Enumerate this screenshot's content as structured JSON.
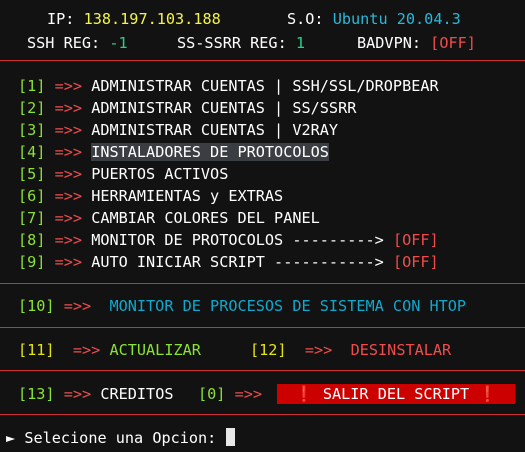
{
  "header": {
    "ip_label": "IP:",
    "ip_value": "138.197.103.188",
    "so_label": "S.O:",
    "so_value": "Ubuntu 20.04.3",
    "ssh_label": "SSH REG:",
    "ssh_value": "-1",
    "ssr_label": "SS-SSRR REG:",
    "ssr_value": "1",
    "badvpn_label": "BADVPN:",
    "badvpn_value": "[OFF]"
  },
  "arrow": "=>>",
  "menu": [
    {
      "num": "[1]",
      "label": "ADMINISTRAR CUENTAS | SSH/SSL/DROPBEAR",
      "status": ""
    },
    {
      "num": "[2]",
      "label": "ADMINISTRAR CUENTAS | SS/SSRR",
      "status": ""
    },
    {
      "num": "[3]",
      "label": "ADMINISTRAR CUENTAS | V2RAY",
      "status": ""
    },
    {
      "num": "[4]",
      "label": "INSTALADORES DE PROTOCOLOS",
      "status": ""
    },
    {
      "num": "[5]",
      "label": "PUERTOS ACTIVOS",
      "status": ""
    },
    {
      "num": "[6]",
      "label": "HERRAMIENTAS y EXTRAS",
      "status": ""
    },
    {
      "num": "[7]",
      "label": "CAMBIAR COLORES DEL PANEL",
      "status": ""
    },
    {
      "num": "[8]",
      "label": "MONITOR DE PROTOCOLOS --------->",
      "status": "[OFF]"
    },
    {
      "num": "[9]",
      "label": "AUTO INICIAR SCRIPT ----------->",
      "status": "[OFF]"
    }
  ],
  "opt10": {
    "num": "[10]",
    "label": "MONITOR DE PROCESOS DE SISTEMA CON HTOP"
  },
  "opt11": {
    "num": "[11]",
    "label": "ACTUALIZAR"
  },
  "opt12": {
    "num": "[12]",
    "label": "DESINSTALAR"
  },
  "opt13": {
    "num": "[13]",
    "label": "CREDITOS"
  },
  "opt0": {
    "num": "[0]",
    "label": "❗ SALIR DEL SCRIPT ❗"
  },
  "prompt": {
    "marker": "►",
    "text": "Selecione una Opcion:"
  },
  "colors": {
    "separator": "#cd3131",
    "exit_bg": "#cd0000",
    "highlight": "#3a3d41"
  }
}
